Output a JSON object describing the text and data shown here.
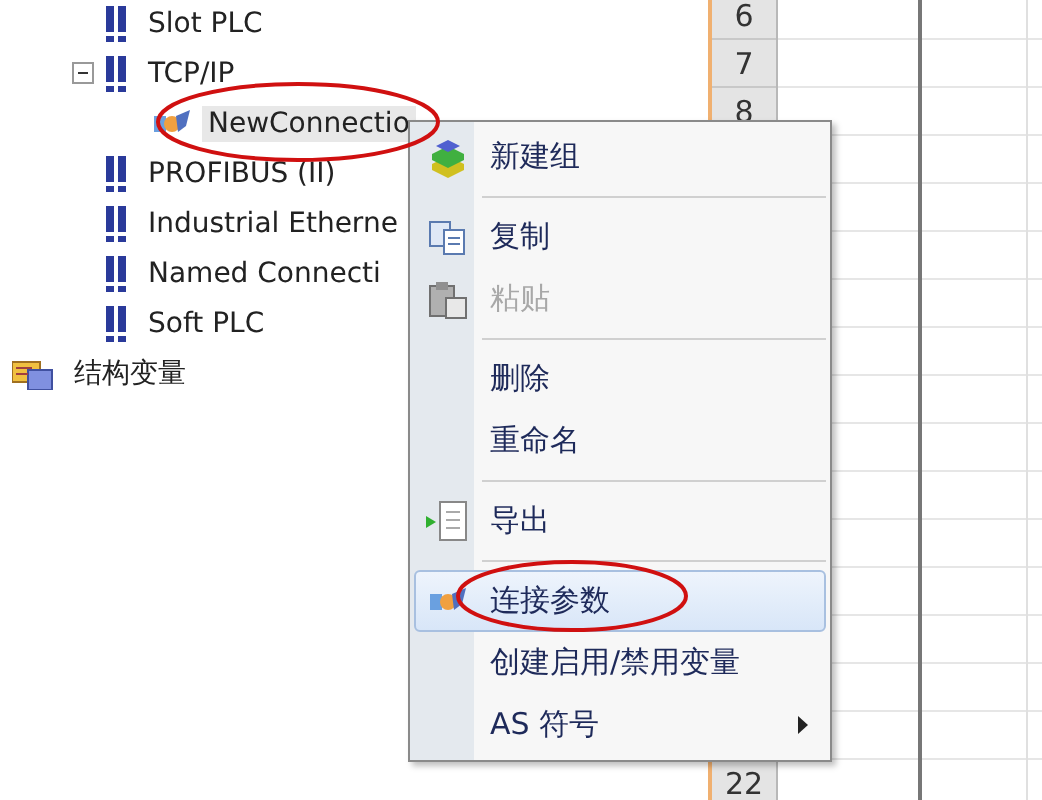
{
  "tree": [
    {
      "label": "Slot PLC"
    },
    {
      "label": "TCP/IP",
      "expanded": true,
      "children": [
        {
          "label": "NewConnectio",
          "selected": true
        }
      ]
    },
    {
      "label": "PROFIBUS (II)"
    },
    {
      "label": "Industrial Etherne"
    },
    {
      "label": "Named Connecti"
    },
    {
      "label": "Soft PLC"
    }
  ],
  "root_item": {
    "label": "结构变量"
  },
  "grid": {
    "top_rows": [
      "6",
      "7",
      "8"
    ],
    "bottom_rows": [
      "22"
    ]
  },
  "context_menu": [
    {
      "kind": "item",
      "label": "新建组",
      "disabled": false,
      "selected": false,
      "submenu": false
    },
    {
      "kind": "separator"
    },
    {
      "kind": "item",
      "label": "复制",
      "disabled": false,
      "selected": false,
      "submenu": false
    },
    {
      "kind": "item",
      "label": "粘贴",
      "disabled": true,
      "selected": false,
      "submenu": false
    },
    {
      "kind": "separator"
    },
    {
      "kind": "item",
      "label": "删除",
      "disabled": false,
      "selected": false,
      "submenu": false
    },
    {
      "kind": "item",
      "label": "重命名",
      "disabled": false,
      "selected": false,
      "submenu": false
    },
    {
      "kind": "separator"
    },
    {
      "kind": "item",
      "label": "导出",
      "disabled": false,
      "selected": false,
      "submenu": false
    },
    {
      "kind": "separator"
    },
    {
      "kind": "item",
      "label": "连接参数",
      "disabled": false,
      "selected": true,
      "submenu": false
    },
    {
      "kind": "item",
      "label": "创建启用/禁用变量",
      "disabled": false,
      "selected": false,
      "submenu": false
    },
    {
      "kind": "item",
      "label": "AS 符号",
      "disabled": false,
      "selected": false,
      "submenu": true
    }
  ]
}
